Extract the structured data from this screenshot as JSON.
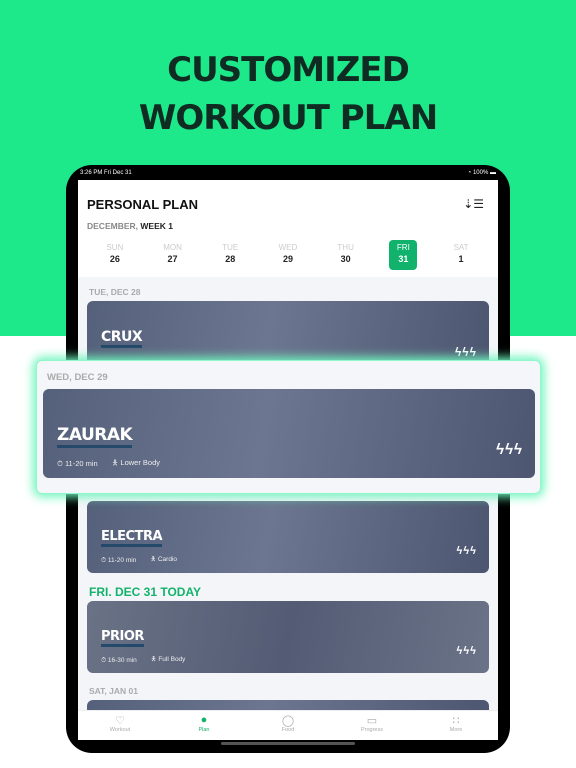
{
  "headline": [
    "CUSTOMIZED",
    "WORKOUT PLAN"
  ],
  "status": {
    "time": "3:26 PM  Fri Dec 31",
    "battery": "100%"
  },
  "header": {
    "title": "PERSONAL PLAN",
    "month": "DECEMBER,",
    "week": "WEEK 1"
  },
  "days": [
    {
      "n": "SUN",
      "d": "26"
    },
    {
      "n": "MON",
      "d": "27"
    },
    {
      "n": "TUE",
      "d": "28"
    },
    {
      "n": "WED",
      "d": "29"
    },
    {
      "n": "THU",
      "d": "30"
    },
    {
      "n": "FRI",
      "d": "31",
      "selected": true
    },
    {
      "n": "SAT",
      "d": "1"
    }
  ],
  "sections": {
    "tue": "TUE, DEC 28",
    "wed": "WED, DEC 29",
    "today": "FRI. DEC 31 TODAY",
    "sat": "SAT, JAN 01"
  },
  "workouts": [
    {
      "name": "CRUX",
      "intensity": 3
    },
    {
      "name": "ZAURAK",
      "duration": "11-20 min",
      "focus": "Lower Body",
      "intensity": 3
    },
    {
      "name": "ELECTRA",
      "duration": "11-20 min",
      "focus": "Cardio",
      "intensity": 1
    },
    {
      "name": "PRIOR",
      "duration": "16-30 min",
      "focus": "Full Body",
      "intensity": 1
    }
  ],
  "tabs": [
    {
      "label": "Workout",
      "icon": "heart-icon"
    },
    {
      "label": "Plan",
      "icon": "plan-icon",
      "active": true
    },
    {
      "label": "Food",
      "icon": "apple-icon"
    },
    {
      "label": "Progress",
      "icon": "progress-icon"
    },
    {
      "label": "More",
      "icon": "grid-icon"
    }
  ],
  "colors": {
    "accent": "#13b36c",
    "background": "#1de98b"
  }
}
